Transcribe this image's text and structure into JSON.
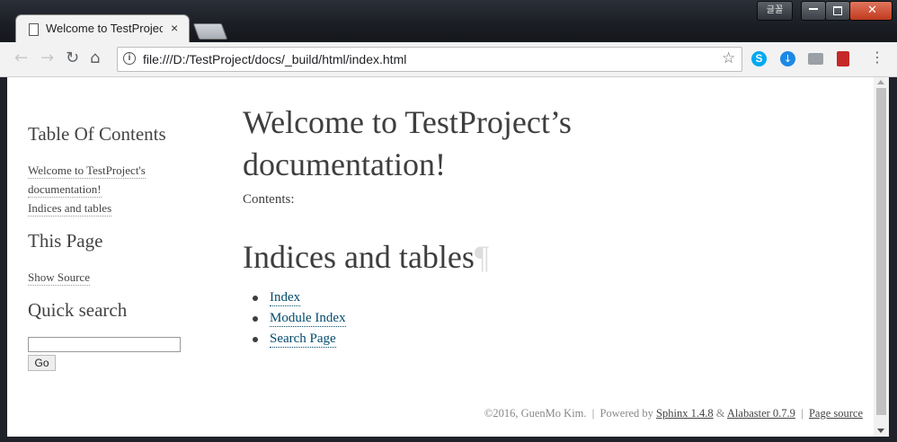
{
  "browser": {
    "tab_title": "Welcome to TestProject's",
    "tab_close": "×",
    "lang_button": "글꼴",
    "url": "file:///D:/TestProject/docs/_build/html/index.html",
    "info_icon_label": "i",
    "back": "←",
    "forward": "→",
    "reload": "↻",
    "home": "⌂",
    "star": "☆",
    "menu": "⋮",
    "extensions": {
      "skype": "S",
      "download": "↓"
    }
  },
  "sidebar": {
    "toc_heading": "Table Of Contents",
    "toc_items": [
      "Welcome to TestProject's",
      "documentation!",
      "Indices and tables"
    ],
    "this_page_heading": "This Page",
    "show_source": "Show Source",
    "search_heading": "Quick search",
    "search_input_value": "",
    "go_button": "Go"
  },
  "main": {
    "title_line1": "Welcome to TestProject’s",
    "title_line2": "documentation!",
    "contents_label": "Contents:",
    "section_heading": "Indices and tables",
    "section_pilcrow": "¶",
    "links": [
      "Index",
      "Module Index",
      "Search Page"
    ]
  },
  "footer": {
    "copyright": "©2016, GuenMo Kim.",
    "sep": "|",
    "powered_by": "Powered by",
    "sphinx": "Sphinx 1.4.8",
    "amp": "&",
    "alabaster": "Alabaster 0.7.9",
    "page_source": "Page source"
  }
}
